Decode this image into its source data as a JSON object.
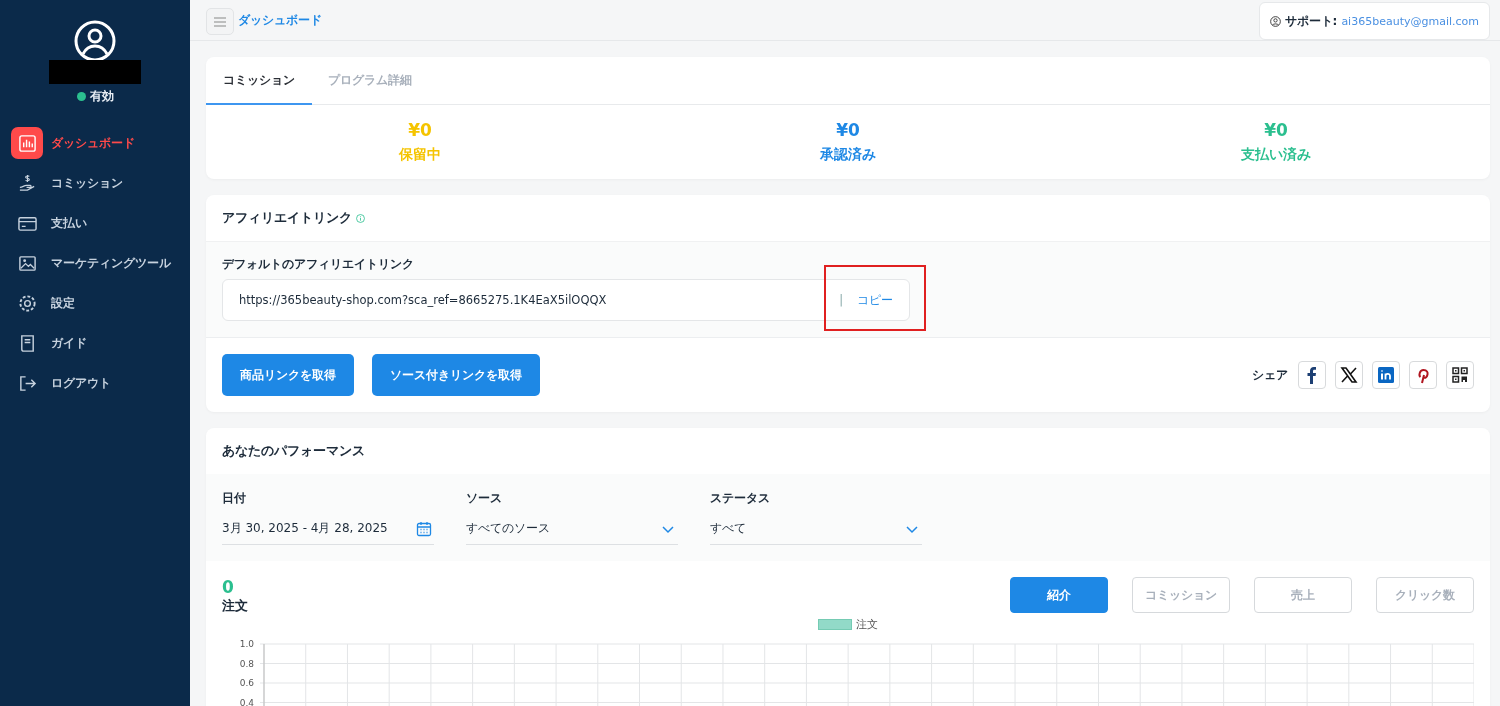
{
  "sidebar": {
    "user": {
      "status": "有効",
      "active": true
    },
    "items": [
      {
        "label": "ダッシュボード",
        "selected": true
      },
      {
        "label": "コミッション",
        "selected": false
      },
      {
        "label": "支払い",
        "selected": false
      },
      {
        "label": "マーケティングツール",
        "selected": false
      },
      {
        "label": "設定",
        "selected": false
      },
      {
        "label": "ガイド",
        "selected": false
      },
      {
        "label": "ログアウト",
        "selected": false
      }
    ]
  },
  "topbar": {
    "breadcrumb": "ダッシュボード",
    "support_label": "サポート:",
    "support_email": "ai365beauty@gmail.com"
  },
  "tabs": [
    {
      "label": "コミッション",
      "selected": true
    },
    {
      "label": "プログラム詳細",
      "selected": false
    }
  ],
  "metrics": [
    {
      "amount": "¥0",
      "label": "保留中",
      "color": "#f5c400"
    },
    {
      "amount": "¥0",
      "label": "承認済み",
      "color": "#1e88e5"
    },
    {
      "amount": "¥0",
      "label": "支払い済み",
      "color": "#2bbf8f"
    }
  ],
  "affiliate": {
    "title": "アフィリエイトリンク",
    "field_label": "デフォルトのアフィリエイトリンク",
    "url": "https://365beauty-shop.com?sca_ref=8665275.1K4EaX5ilOQQX",
    "separator": "|",
    "copy": "コピー",
    "buttons": [
      "商品リンクを取得",
      "ソース付きリンクを取得"
    ],
    "share_label": "シェア"
  },
  "performance": {
    "title": "あなたのパフォーマンス",
    "filters": [
      {
        "kind": "date",
        "label": "日付",
        "value": "3月 30, 2025 - 4月 28, 2025"
      },
      {
        "kind": "select",
        "label": "ソース",
        "value": "すべてのソース"
      },
      {
        "kind": "select",
        "label": "ステータス",
        "value": "すべて"
      }
    ],
    "total": "0",
    "total_label": "注文",
    "metric_buttons": [
      {
        "label": "紹介",
        "selected": true
      },
      {
        "label": "コミッション",
        "selected": false
      },
      {
        "label": "売上",
        "selected": false
      },
      {
        "label": "クリック数",
        "selected": false
      }
    ],
    "chart_data": {
      "type": "line",
      "grid": true,
      "ylim": [
        0,
        1
      ],
      "yticks": [
        0.4,
        0.6,
        0.8,
        {
          "value": 1,
          "label": "1.0"
        }
      ],
      "series": [
        {
          "name": "注文",
          "color": "#7fd4bf"
        }
      ]
    }
  }
}
